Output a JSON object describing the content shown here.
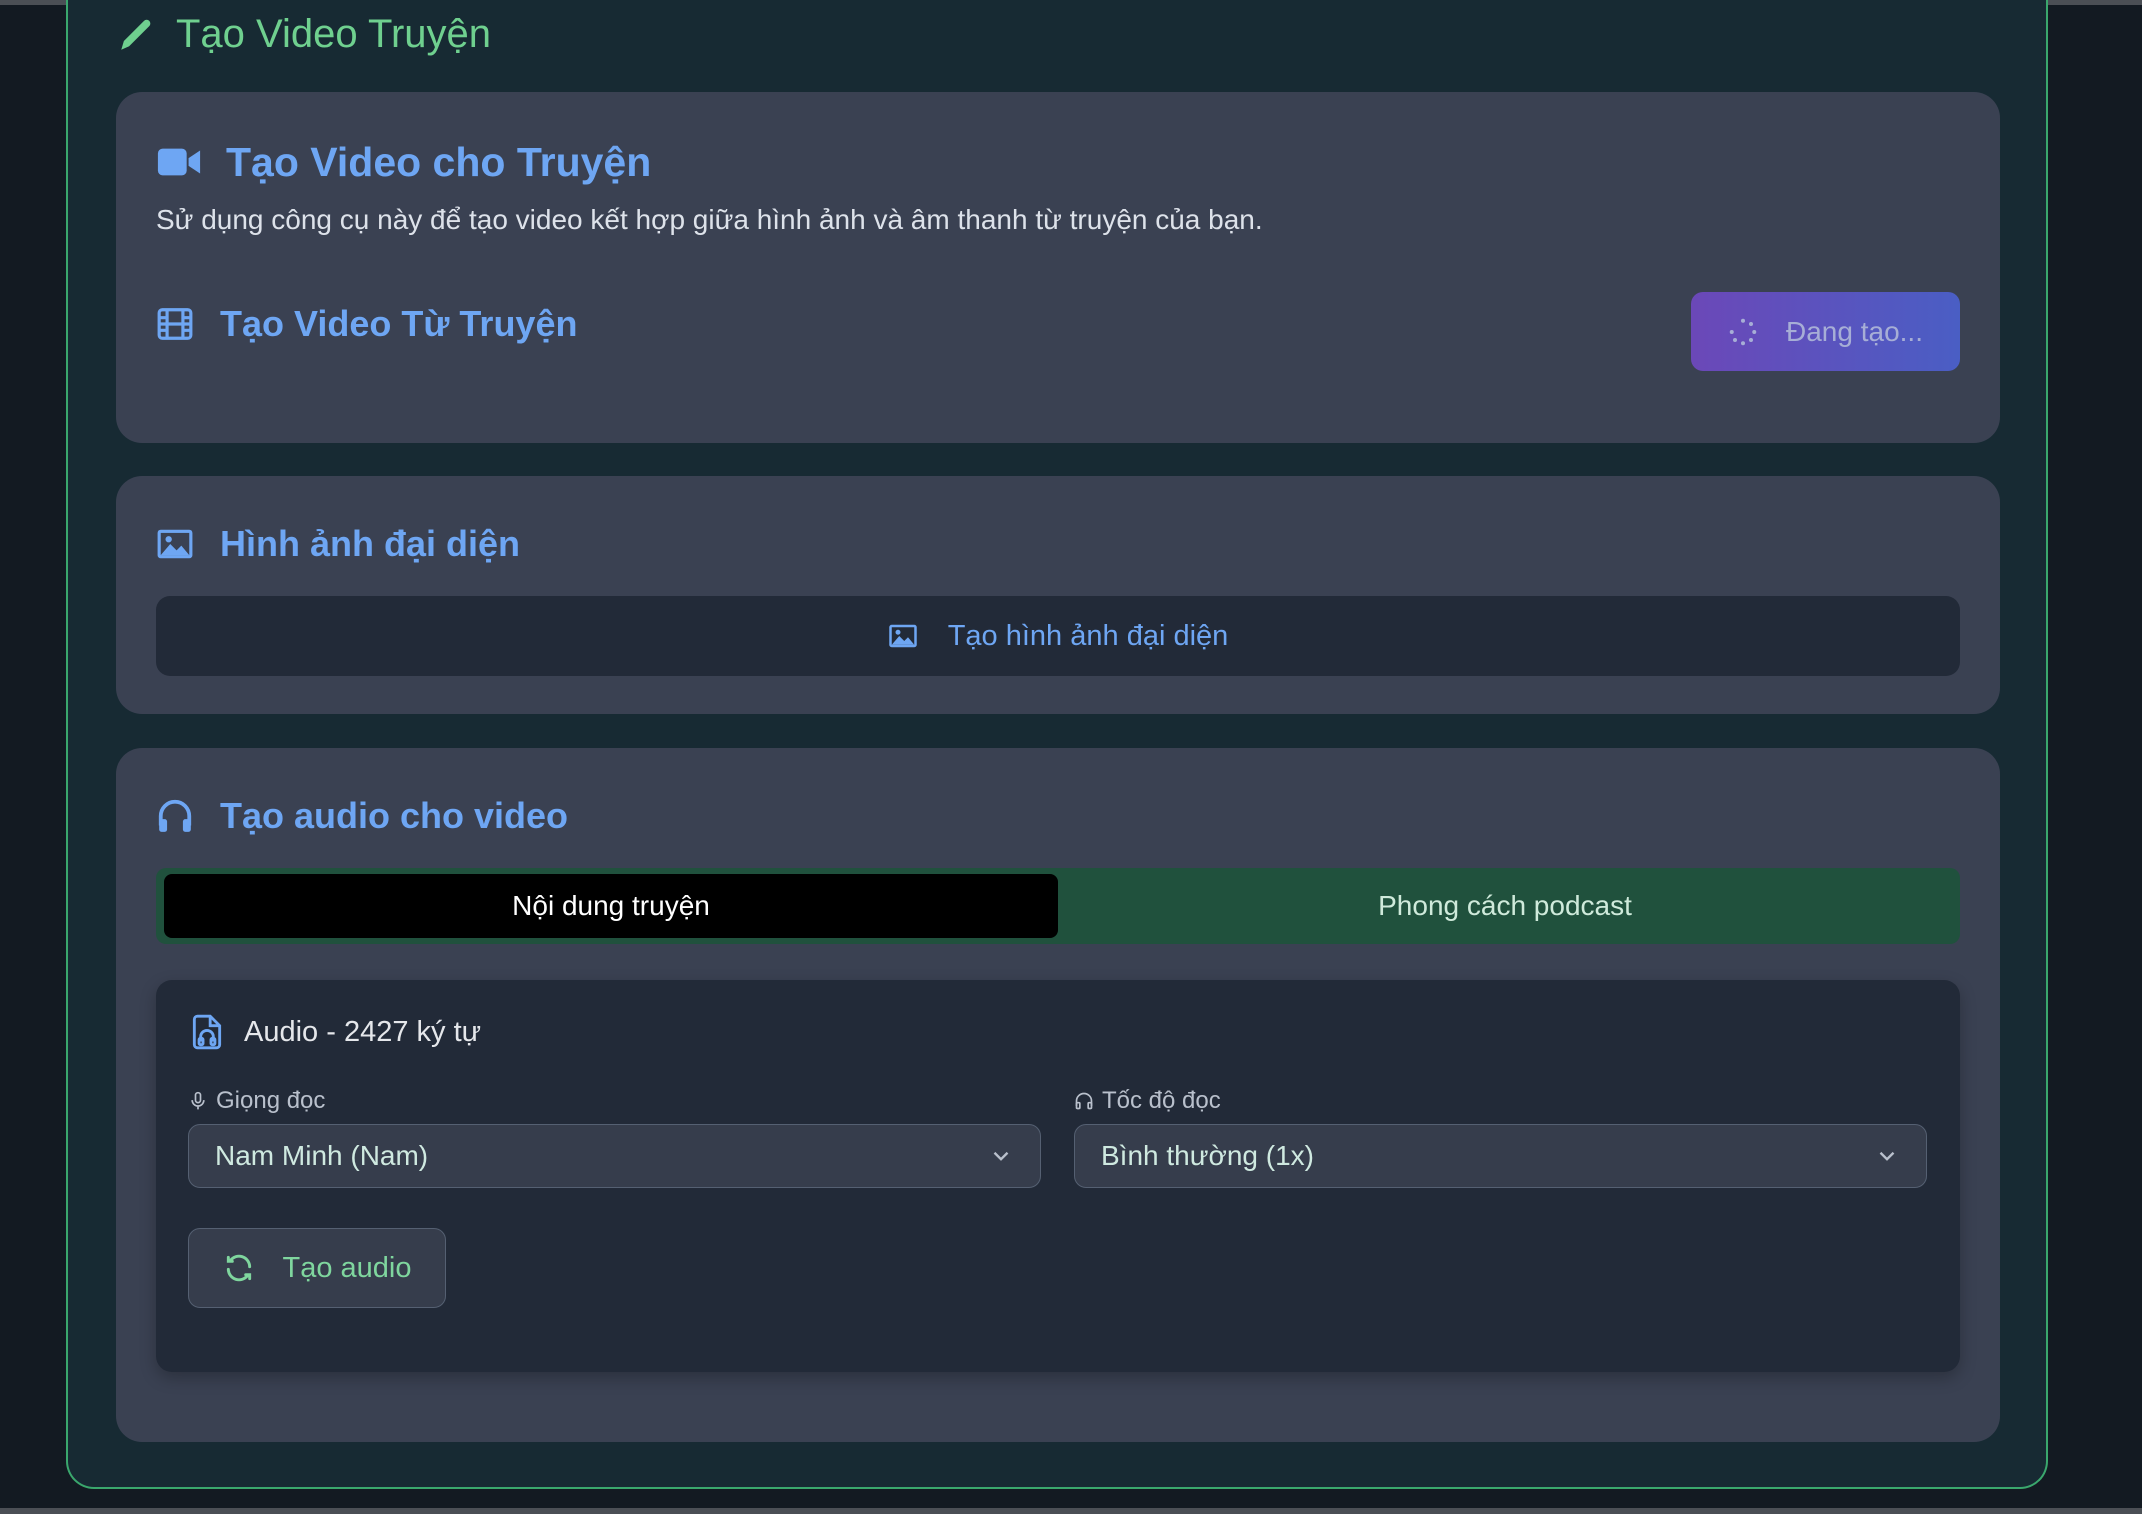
{
  "page": {
    "title": "Tạo Video Truyện"
  },
  "video_section": {
    "title": "Tạo Video cho Truyện",
    "description": "Sử dụng công cụ này để tạo video kết hợp giữa hình ảnh và âm thanh từ truyện của bạn.",
    "subtitle": "Tạo Video Từ Truyện",
    "generate_button_label": "Đang tạo..."
  },
  "thumbnail_section": {
    "title": "Hình ảnh đại diện",
    "button_label": "Tạo hình ảnh đại diện"
  },
  "audio_section": {
    "title": "Tạo audio cho video",
    "tabs": [
      {
        "label": "Nội dung truyện",
        "active": true
      },
      {
        "label": "Phong cách podcast",
        "active": false
      }
    ],
    "panel": {
      "title": "Audio - 2427 ký tự",
      "voice_label": "Giọng đọc",
      "voice_value": "Nam Minh (Nam)",
      "speed_label": "Tốc độ đọc",
      "speed_value": "Bình thường (1x)",
      "create_button_label": "Tạo audio"
    }
  },
  "colors": {
    "accent_blue": "#6ea6f3",
    "accent_green": "#6fd08f",
    "card_bg": "#3a4152",
    "panel_bg": "#222a38"
  },
  "icons": [
    "pencil-icon",
    "video-camera-icon",
    "film-icon",
    "spinner-icon",
    "image-icon",
    "headphones-icon",
    "audio-file-icon",
    "microphone-icon",
    "chevron-down-icon",
    "refresh-icon"
  ]
}
